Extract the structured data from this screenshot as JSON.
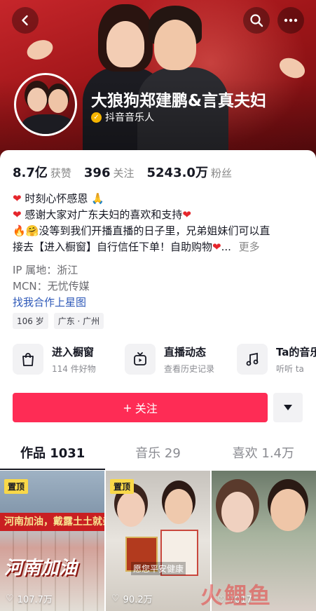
{
  "header": {
    "name": "大狼狗郑建鹏&言真夫妇",
    "verified_label": "抖音音乐人"
  },
  "stats": [
    {
      "value": "8.7亿",
      "label": "获赞"
    },
    {
      "value": "396",
      "label": "关注"
    },
    {
      "value": "5243.0万",
      "label": "粉丝"
    }
  ],
  "bio": {
    "line1": "时刻心怀感恩",
    "line2": "感谢大家对广东夫妇的喜欢和支持",
    "line3": "没等到我们开播直播的日子里，兄弟姐妹们可以直",
    "line4": "接去【进入橱窗】自行信任下单！自助购物",
    "more": "更多"
  },
  "meta": {
    "ip": "IP 属地：浙江",
    "mcn": "MCN：无忧传媒",
    "link": "找我合作上星图"
  },
  "tags": [
    "106 岁",
    "广东 · 广州"
  ],
  "entries": [
    {
      "title": "进入橱窗",
      "subtitle": "114 件好物",
      "icon": "bag-icon"
    },
    {
      "title": "直播动态",
      "subtitle": "查看历史记录",
      "icon": "tv-icon"
    },
    {
      "title": "Ta的音乐",
      "subtitle": "听听 ta",
      "icon": "music-icon"
    }
  ],
  "actions": {
    "follow_label": "关注"
  },
  "tabs": [
    {
      "label": "作品 1031",
      "active": true
    },
    {
      "label": "音乐 29",
      "active": false
    },
    {
      "label": "喜欢 1.4万",
      "active": false
    }
  ],
  "videos": [
    {
      "pinned": "置顶",
      "likes": "107.7万",
      "overlay_banner": "河南加油，戴露土土就亲兄弟同心",
      "overlay_title": "河南加油"
    },
    {
      "pinned": "置顶",
      "likes": "90.2万",
      "overlay_caption": "愿您平安健康"
    },
    {
      "likes": "7017"
    }
  ],
  "watermark": "火鲤鱼",
  "colors": {
    "accent": "#fe2c55",
    "banner": "#9e1518",
    "link": "#2d58b8",
    "pin": "#f9d849"
  }
}
